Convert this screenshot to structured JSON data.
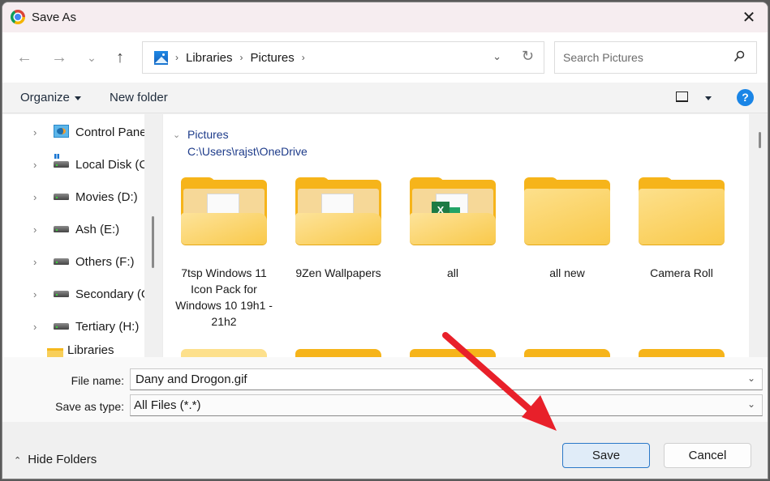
{
  "window": {
    "title": "Save As",
    "app_icon": "chrome-icon",
    "close_label": "✕"
  },
  "nav": {
    "back_icon": "←",
    "forward_icon": "→",
    "recent_icon": "⌄",
    "up_icon": "↑",
    "breadcrumb": [
      "Libraries",
      "Pictures"
    ],
    "breadcrumb_sep": "›",
    "address_dropdown_icon": "⌄",
    "refresh_icon": "↻",
    "search_placeholder": "Search Pictures"
  },
  "toolbar": {
    "organize_label": "Organize",
    "new_folder_label": "New folder",
    "help_label": "?"
  },
  "sidebar": {
    "items": [
      {
        "label": "Control Panel",
        "icon": "control-panel-icon"
      },
      {
        "label": "Local Disk (C:)",
        "icon": "system-drive-icon"
      },
      {
        "label": "Movies (D:)",
        "icon": "drive-icon"
      },
      {
        "label": "Ash (E:)",
        "icon": "drive-icon"
      },
      {
        "label": "Others (F:)",
        "icon": "drive-icon"
      },
      {
        "label": "Secondary (G:)",
        "icon": "drive-icon"
      },
      {
        "label": "Tertiary (H:)",
        "icon": "drive-icon"
      },
      {
        "label": "Libraries",
        "icon": "folder-icon"
      }
    ],
    "chevron": "›",
    "chevron_expanded": "⌄"
  },
  "content": {
    "group_title": "Pictures",
    "group_path": "C:\\Users\\rajst\\OneDrive",
    "group_chevron": "⌄",
    "folders": [
      {
        "name": "7tsp Windows 11 Icon Pack for Windows 10 19h1 - 21h2",
        "type": "open-doc"
      },
      {
        "name": "9Zen Wallpapers",
        "type": "open-doc"
      },
      {
        "name": "all",
        "type": "open-excel"
      },
      {
        "name": "all new",
        "type": "plain"
      },
      {
        "name": "Camera Roll",
        "type": "plain"
      }
    ]
  },
  "fields": {
    "file_name_label": "File name:",
    "file_name_value": "Dany and Drogon.gif",
    "save_type_label": "Save as type:",
    "save_type_value": "All Files (*.*)",
    "dropdown_icon": "⌄"
  },
  "footer": {
    "hide_folders_label": "Hide Folders",
    "hide_folders_icon": "⌃",
    "save_label": "Save",
    "cancel_label": "Cancel"
  },
  "colors": {
    "annotation_arrow": "#e8202a",
    "accent": "#1a85e6",
    "link": "#1d3b8a",
    "folder": "#f6b41a"
  }
}
